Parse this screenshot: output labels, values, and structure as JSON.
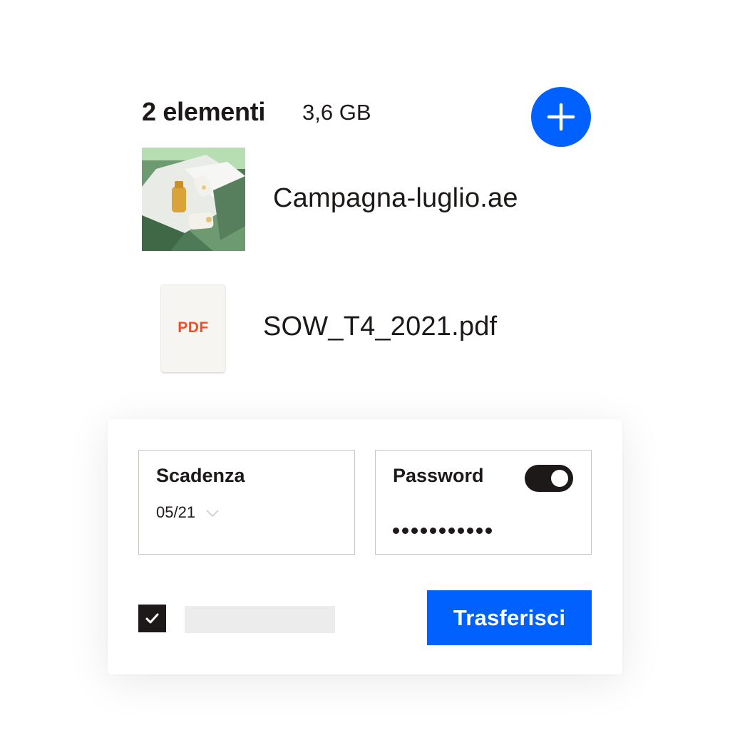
{
  "header": {
    "item_count": "2 elementi",
    "total_size": "3,6 GB",
    "add_icon": "plus-icon",
    "accent_color": "#0061fe"
  },
  "files": [
    {
      "name": "Campagna-luglio.ae",
      "icon": "image-thumbnail"
    },
    {
      "name": "SOW_T4_2021.pdf",
      "icon": "pdf-file-icon",
      "badge": "PDF",
      "badge_color": "#f04f23"
    }
  ],
  "panel": {
    "expiry": {
      "label": "Scadenza",
      "value": "05/21",
      "icon": "chevron-down-icon"
    },
    "password": {
      "label": "Password",
      "toggle_on": true,
      "masked_value": "•••••••••••"
    },
    "agree_checkbox": {
      "checked": true,
      "icon": "checkmark-icon"
    },
    "submit_label": "Trasferisci",
    "submit_color": "#0061fe"
  }
}
